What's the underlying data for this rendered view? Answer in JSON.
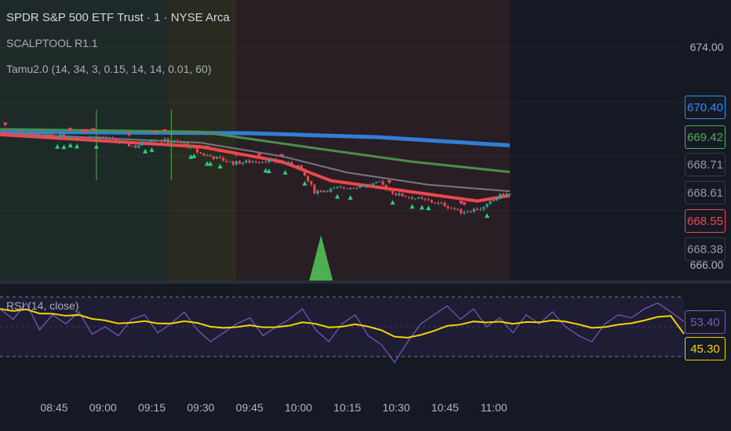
{
  "header": {
    "symbol_title": "SPDR S&P 500 ETF Trust · 1 · NYSE Arca",
    "indicator1": "SCALPTOOL R1.1",
    "indicator2": "Tamu2.0 (14, 34, 3, 0.15, 14, 14, 0.01, 60)",
    "rsi_title": "RSI (14, close)"
  },
  "price_axis": {
    "top_label": "674.00",
    "hidden_label": "666.00"
  },
  "price_labels": [
    {
      "value": "670.40",
      "color": "#2f8ff0"
    },
    {
      "value": "669.42",
      "color": "#4caf50"
    },
    {
      "value": "668.71",
      "color": "#9598a1"
    },
    {
      "value": "668.61",
      "color": "#9598a1"
    },
    {
      "value": "668.55",
      "color": "#f0474f"
    },
    {
      "value": "668.38",
      "color": "#9598a1"
    }
  ],
  "rsi_labels": [
    {
      "value": "53.40",
      "color": "#7e57c2"
    },
    {
      "value": "45.30",
      "color": "#f5d300"
    }
  ],
  "time_axis": [
    "08:45",
    "09:00",
    "09:15",
    "09:30",
    "09:45",
    "10:00",
    "10:15",
    "10:30",
    "10:45",
    "11:00"
  ],
  "chart_data": {
    "type": "candlestick",
    "price_range": [
      666,
      674
    ],
    "close_path": [
      [
        -17,
        670.9
      ],
      [
        0,
        670.75
      ],
      [
        15,
        670.7
      ],
      [
        25,
        670.35
      ],
      [
        30,
        670.65
      ],
      [
        40,
        670.45
      ],
      [
        45,
        670.1
      ],
      [
        55,
        669.75
      ],
      [
        65,
        669.85
      ],
      [
        75,
        669.65
      ],
      [
        80,
        668.7
      ],
      [
        90,
        668.85
      ],
      [
        100,
        669.0
      ],
      [
        105,
        668.6
      ],
      [
        115,
        668.35
      ],
      [
        120,
        668.2
      ],
      [
        125,
        667.95
      ],
      [
        132,
        668.1
      ],
      [
        137,
        668.55
      ],
      [
        140,
        668.61
      ]
    ],
    "blue_ma": [
      [
        -17,
        670.9
      ],
      [
        60,
        670.85
      ],
      [
        100,
        670.7
      ],
      [
        140,
        670.4
      ]
    ],
    "green_ma": [
      [
        -17,
        671.0
      ],
      [
        45,
        670.9
      ],
      [
        80,
        670.3
      ],
      [
        110,
        669.8
      ],
      [
        140,
        669.42
      ]
    ],
    "gray_ma": [
      [
        -17,
        670.85
      ],
      [
        45,
        670.5
      ],
      [
        70,
        670.0
      ],
      [
        90,
        669.4
      ],
      [
        115,
        668.95
      ],
      [
        140,
        668.71
      ]
    ],
    "red_ma": [
      [
        -17,
        670.8
      ],
      [
        45,
        670.35
      ],
      [
        70,
        669.8
      ],
      [
        85,
        669.1
      ],
      [
        115,
        668.6
      ],
      [
        130,
        668.35
      ],
      [
        140,
        668.55
      ]
    ],
    "rsi": [
      62,
      55,
      66,
      48,
      58,
      52,
      60,
      45,
      50,
      44,
      55,
      58,
      46,
      52,
      60,
      48,
      40,
      46,
      52,
      56,
      44,
      50,
      55,
      62,
      48,
      40,
      52,
      58,
      44,
      38,
      26,
      40,
      52,
      58,
      64,
      55,
      62,
      50,
      56,
      46,
      58,
      52,
      60,
      50,
      44,
      40,
      52,
      58,
      56,
      62,
      66,
      60,
      53.4
    ],
    "rsi_ma_end": 45.3,
    "rsi_levels": [
      70,
      30
    ],
    "session_bands": [
      {
        "from": -17,
        "to": 35,
        "color": "#1e2a27"
      },
      {
        "from": 35,
        "to": 56,
        "color": "#2a2b20"
      },
      {
        "from": 56,
        "to": 140,
        "color": "#2a1e25"
      }
    ],
    "signal_time": 82
  }
}
